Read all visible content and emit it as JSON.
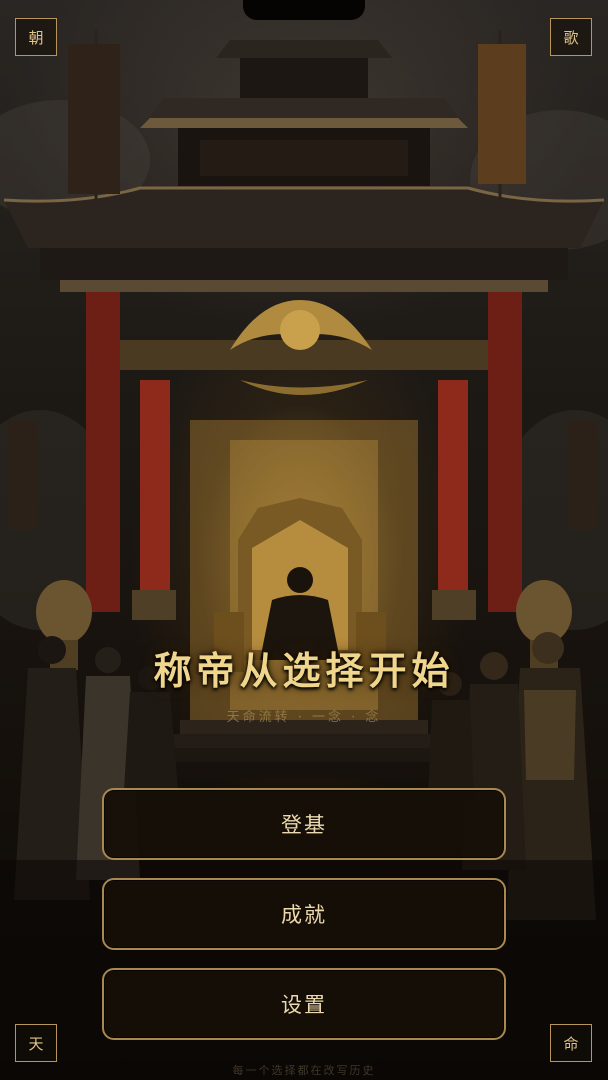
{
  "corners": {
    "top_left": "朝",
    "top_right": "歌",
    "bottom_left": "天",
    "bottom_right": "命"
  },
  "title": "称帝从选择开始",
  "subtitle": "天命流转 · 一念 · 念",
  "menu": {
    "start": "登基",
    "achievements": "成就",
    "settings": "设置"
  },
  "footer": "每一个选择都在改写历史",
  "colors": {
    "gold": "#f0d68c",
    "button_border": "#a9894f",
    "button_bg": "#160f08",
    "pillar_red": "#8e2a1c"
  },
  "icons": [
    "palace-backdrop",
    "throne",
    "emperor-figure",
    "dragon-ornament",
    "banner",
    "incense-urn",
    "warrior-guard",
    "official-figure"
  ]
}
